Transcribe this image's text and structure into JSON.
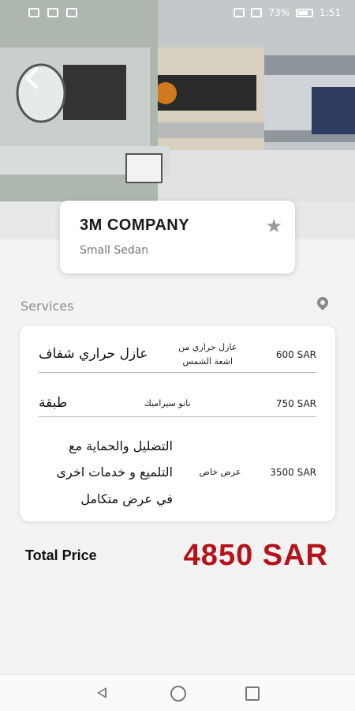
{
  "status_bar": {
    "battery": "73%",
    "time": "1:51"
  },
  "company": {
    "name": "3M COMPANY",
    "type": "Small Sedan"
  },
  "services": {
    "label": "Services",
    "items": [
      {
        "name": "عازل حراري شفاف",
        "description": "عازل حراري من اشعة الشمس",
        "price": "600 SAR"
      },
      {
        "name": "طبقة",
        "description": "نانو سيراميك",
        "price": "750 SAR"
      },
      {
        "name": "التضليل والحماية مع التلميع و خدمات اخرى في عرض متكامل",
        "description": "عرض خاص",
        "price": "3500 SAR"
      }
    ]
  },
  "total": {
    "label": "Total Price",
    "value": "4850 SAR"
  },
  "colors": {
    "price_accent": "#b5121b",
    "background": "#f3f3f3"
  }
}
